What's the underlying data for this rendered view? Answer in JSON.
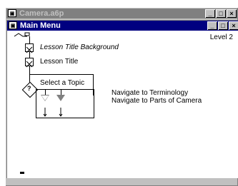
{
  "outer_window": {
    "title": "Camera.a6p",
    "icon": "authorware-icon"
  },
  "inner_window": {
    "title": "Main Menu",
    "icon": "authorware-icon"
  },
  "level_label": "Level 2",
  "flowline": {
    "icons": [
      {
        "label": "Lesson Title Background",
        "italic": true,
        "icon": "display-icon"
      },
      {
        "label": "Lesson Title",
        "italic": false,
        "icon": "display-icon"
      }
    ],
    "interaction": {
      "label": "Select a Topic",
      "icon": "interaction-icon"
    },
    "responses": [
      {
        "label": "Navigate to Terminology"
      },
      {
        "label": "Navigate to Parts of Camera"
      }
    ]
  },
  "window_buttons": {
    "minimize": "_",
    "maximize": "□",
    "close": "×"
  },
  "colors": {
    "active_title": "#000080",
    "inactive_title": "#808080"
  }
}
